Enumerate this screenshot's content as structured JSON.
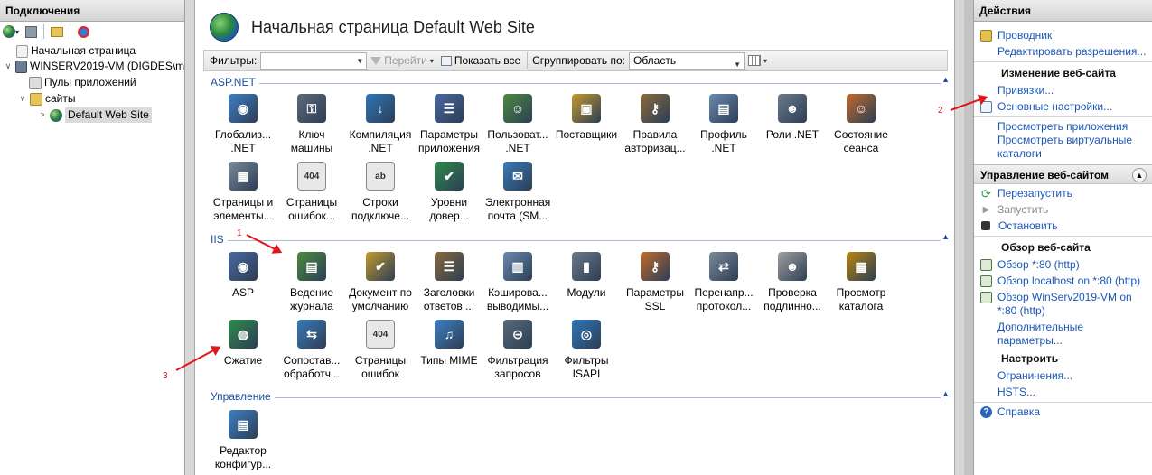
{
  "connections": {
    "header": "Подключения",
    "tree": [
      {
        "label": "Начальная страница"
      },
      {
        "label": "WINSERV2019-VM (DIGDES\\m"
      },
      {
        "label": "Пулы приложений"
      },
      {
        "label": "сайты"
      },
      {
        "label": "Default Web Site"
      }
    ]
  },
  "center": {
    "title": "Начальная страница Default Web Site",
    "filter": {
      "label": "Фильтры:",
      "go_label": "Перейти",
      "show_all_label": "Показать все",
      "group_label": "Сгруппировать по:",
      "group_value": "Область"
    },
    "sections": [
      {
        "name": "ASP.NET"
      },
      {
        "name": "IIS"
      },
      {
        "name": "Управление"
      }
    ],
    "aspnet_items": [
      {
        "label": "Глобализ...\n.NET"
      },
      {
        "label": "Ключ\nмашины"
      },
      {
        "label": "Компиляция\n.NET"
      },
      {
        "label": "Параметры\nприложения"
      },
      {
        "label": "Пользоват...\n.NET"
      },
      {
        "label": "Поставщики"
      },
      {
        "label": "Правила\nавторизац..."
      },
      {
        "label": "Профиль\n.NET"
      },
      {
        "label": "Роли .NET"
      },
      {
        "label": "Состояние\nсеанса"
      },
      {
        "label": "Страницы и\nэлементы..."
      },
      {
        "label": "Страницы\nошибок..."
      },
      {
        "label": "Строки\nподключе..."
      },
      {
        "label": "Уровни\nдовер..."
      },
      {
        "label": "Электронная\nпочта (SM..."
      }
    ],
    "iis_items": [
      {
        "label": "ASP"
      },
      {
        "label": "Ведение\nжурнала"
      },
      {
        "label": "Документ по\nумолчанию"
      },
      {
        "label": "Заголовки\nответов ..."
      },
      {
        "label": "Кэширова...\nвыводимы..."
      },
      {
        "label": "Модули"
      },
      {
        "label": "Параметры\nSSL"
      },
      {
        "label": "Перенапр...\nпротокол..."
      },
      {
        "label": "Проверка\nподлинно..."
      },
      {
        "label": "Просмотр\nкаталога"
      },
      {
        "label": "Сжатие"
      },
      {
        "label": "Сопостав...\nобработч..."
      },
      {
        "label": "Страницы\nошибок"
      },
      {
        "label": "Типы MIME"
      },
      {
        "label": "Фильтрация\nзапросов"
      },
      {
        "label": "Фильтры\nISAPI"
      }
    ],
    "mgmt_items": [
      {
        "label": "Редактор\nконфигур..."
      }
    ]
  },
  "actions": {
    "header": "Действия",
    "explorer": "Проводник",
    "edit_perms": "Редактировать разрешения...",
    "edit_site_h": "Изменение веб-сайта",
    "bindings": "Привязки...",
    "basic_settings": "Основные настройки...",
    "view_apps": "Просмотреть приложения",
    "view_vdirs": "Просмотреть виртуальные каталоги",
    "manage_h": "Управление веб-сайтом",
    "restart": "Перезапустить",
    "start": "Запустить",
    "stop": "Остановить",
    "browse_h": "Обзор веб-сайта",
    "browse1": "Обзор *:80 (http)",
    "browse2": "Обзор localhost on *:80 (http)",
    "browse3": "Обзор WinServ2019-VM on *:80 (http)",
    "advanced": "Дополнительные параметры...",
    "configure_h": "Настроить",
    "limits": "Ограничения...",
    "hsts": "HSTS...",
    "help": "Справка"
  },
  "annotations": {
    "n1": "1",
    "n2": "2",
    "n3": "3"
  },
  "colors": {
    "link": "#1b57b8",
    "section": "#1b4f9c",
    "arrow": "#e0161a"
  }
}
